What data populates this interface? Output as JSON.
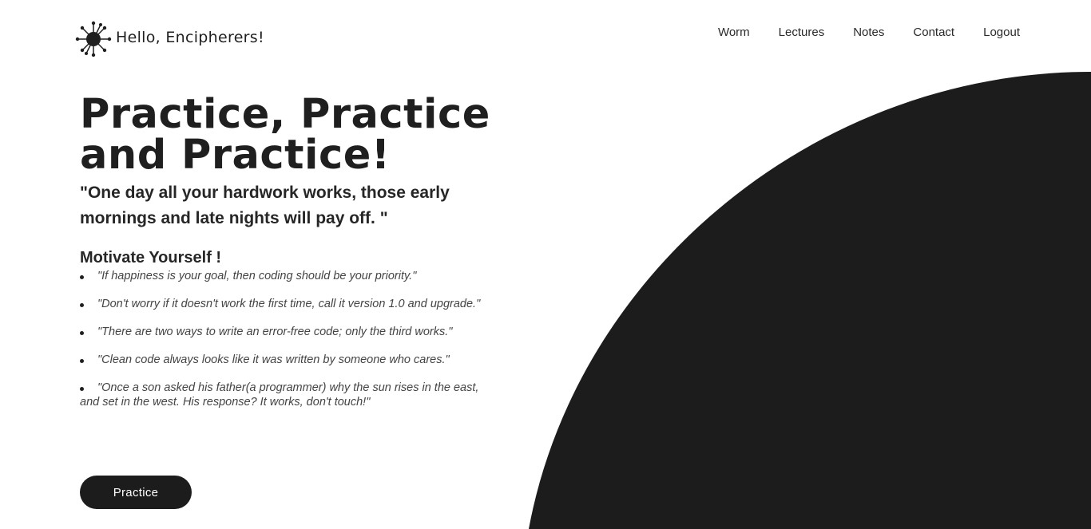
{
  "header": {
    "brand": "Hello, Encipherers!",
    "logo_icon": "virus-icon",
    "nav": [
      "Worm",
      "Lectures",
      "Notes",
      "Contact",
      "Logout"
    ]
  },
  "hero": {
    "title_line1": "Practice, Practice",
    "title_line2": "and Practice!",
    "quote": "\"One day all your hardwork works, those early mornings and late nights will pay off. \"",
    "subhead": "Motivate Yourself !",
    "quotes": [
      "\"If happiness is your goal, then coding should be your priority.\"",
      "\"Don't worry if it doesn't work the first time, call it version 1.0 and upgrade.\"",
      "\"There are two ways to write an error-free code; only the third works.\"",
      "\"Clean code always looks like it was written by someone who cares.\"",
      "\"Once a son asked his father(a programmer) why the sun rises in the east, and set in the west. His response? It works, don't touch!\""
    ],
    "button_label": "Practice"
  },
  "colors": {
    "primary": "#1c1c1c",
    "background": "#ffffff"
  }
}
